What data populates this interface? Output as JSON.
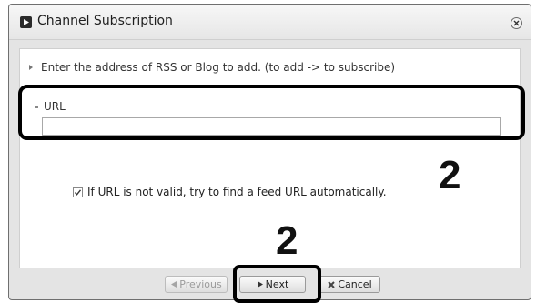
{
  "dialog": {
    "title": "Channel Subscription",
    "instruction": "Enter the address of RSS or Blog to add. (to add -> to subscribe)",
    "url_label": "URL",
    "url_value": "",
    "checkbox_label": "If URL is not valid, try to find a feed URL automatically.",
    "checkbox_checked": true
  },
  "buttons": {
    "previous": "Previous",
    "next": "Next",
    "cancel": "Cancel"
  },
  "annotations": {
    "step_right": "2",
    "step_bottom": "2"
  },
  "icons": {
    "title": "channel-icon",
    "close": "close-icon",
    "previous": "arrow-left-icon",
    "next": "arrow-right-icon",
    "cancel": "cancel-icon"
  }
}
